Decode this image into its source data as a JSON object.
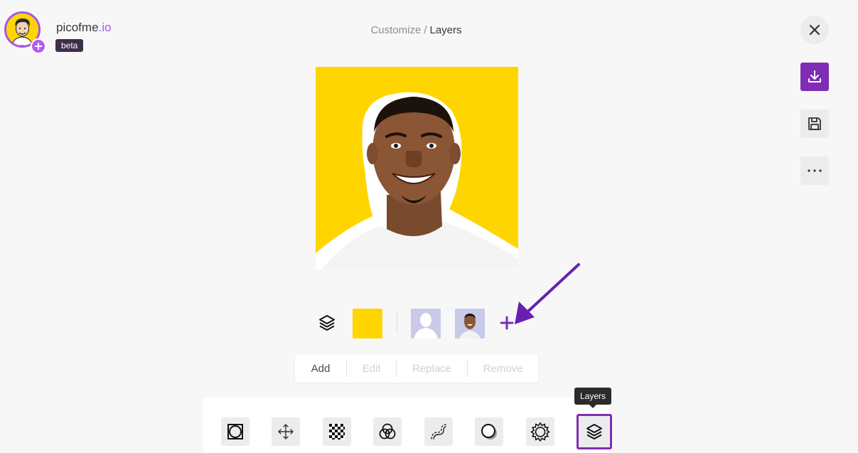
{
  "brand": {
    "name_main": "picofme",
    "name_accent": ".io",
    "badge": "beta",
    "icons": {
      "avatar": "user-avatar",
      "add": "plus-icon"
    }
  },
  "breadcrumb": {
    "parent": "Customize",
    "separator": "/",
    "current": "Layers"
  },
  "header_actions": {
    "close": "close-icon",
    "download": "download-icon",
    "save": "save-icon",
    "more": "more-horizontal-icon"
  },
  "layer_strip": {
    "background_color": "#ffd500",
    "add_icon": "plus-icon"
  },
  "layer_actions": {
    "add": "Add",
    "edit": "Edit",
    "replace": "Replace",
    "remove": "Remove"
  },
  "tools": {
    "items": [
      {
        "icon": "border-icon"
      },
      {
        "icon": "move-icon"
      },
      {
        "icon": "transparency-icon"
      },
      {
        "icon": "color-blend-icon"
      },
      {
        "icon": "curve-path-icon"
      },
      {
        "icon": "shadow-icon"
      },
      {
        "icon": "adjust-icon"
      },
      {
        "icon": "layers-icon",
        "selected": true
      }
    ],
    "tooltip": "Layers"
  },
  "colors": {
    "accent": "#7e2db4",
    "accent_light": "#a855f7",
    "canvas_background": "#ffd500"
  }
}
